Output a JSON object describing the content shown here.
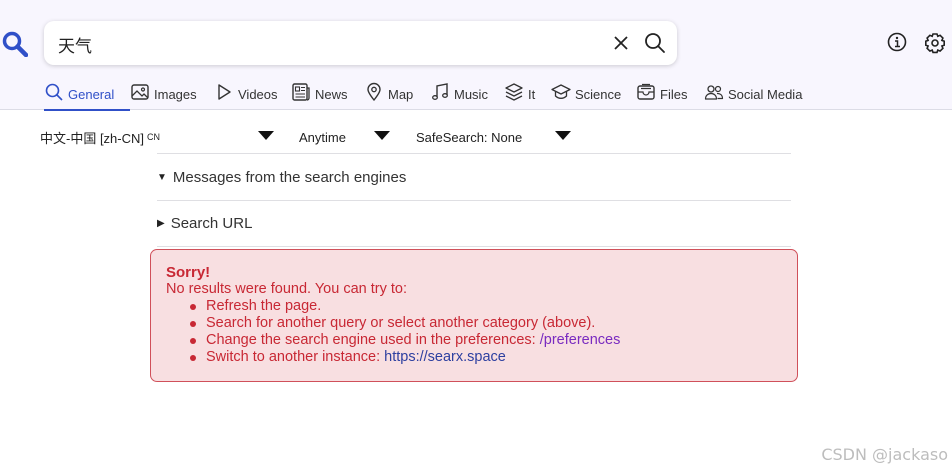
{
  "search": {
    "query": "天气"
  },
  "tabs": [
    {
      "label": "General",
      "icon": "search-icon"
    },
    {
      "label": "Images",
      "icon": "image-icon"
    },
    {
      "label": "Videos",
      "icon": "play-icon"
    },
    {
      "label": "News",
      "icon": "newspaper-icon"
    },
    {
      "label": "Map",
      "icon": "map-pin-icon"
    },
    {
      "label": "Music",
      "icon": "music-note-icon"
    },
    {
      "label": "It",
      "icon": "layers-icon"
    },
    {
      "label": "Science",
      "icon": "school-icon"
    },
    {
      "label": "Files",
      "icon": "file-tray-icon"
    },
    {
      "label": "Social Media",
      "icon": "people-icon"
    }
  ],
  "filters": {
    "language": "中文-中国 [zh-CN]",
    "language_code": "CN",
    "time": "Anytime",
    "safesearch": "SafeSearch: None"
  },
  "details": {
    "messages": "Messages from the search engines",
    "search_url": "Search URL"
  },
  "alert": {
    "title": "Sorry!",
    "message": "No results were found. You can try to:",
    "items": [
      "Refresh the page.",
      "Search for another query or select another category (above).",
      "Change the search engine used in the preferences: ",
      "Switch to another instance: "
    ],
    "preferences_link": "/preferences",
    "instance_link": "https://searx.space"
  },
  "watermark": "CSDN @jackaso",
  "colors": {
    "accent": "#3050c8",
    "alert_bg": "#f8dfe1",
    "alert_text": "#c82834",
    "header_bg": "#f8f6fe"
  }
}
